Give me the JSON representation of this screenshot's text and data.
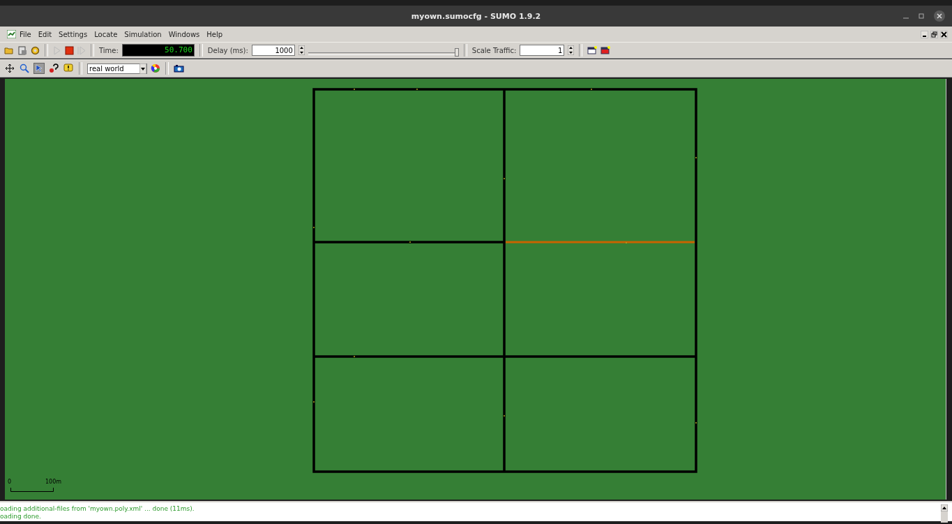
{
  "window": {
    "title": "myown.sumocfg - SUMO 1.9.2"
  },
  "menu": [
    "File",
    "Edit",
    "Settings",
    "Locate",
    "Simulation",
    "Windows",
    "Help"
  ],
  "sim_toolbar": {
    "time_label": "Time:",
    "time": "50.700",
    "delay_label": "Delay (ms):",
    "delay": "1000",
    "delay_slider": {
      "level": 1.0
    },
    "scale_label": "Scale Traffic:",
    "scale": "1"
  },
  "view_toolbar": {
    "tools": [
      {
        "kind": "recenter",
        "selected": false
      },
      {
        "kind": "locate",
        "selected": false
      },
      {
        "kind": "select",
        "selected": true
      },
      {
        "kind": "edit-breakpoints",
        "selected": false
      },
      {
        "kind": "tooltip",
        "selected": false
      }
    ],
    "scheme": "real world"
  },
  "canvas": {
    "scale_bar": {
      "start": "0",
      "end": "100m"
    },
    "highlighted_edge": {
      "color": "#c86400"
    }
  },
  "log": [
    "oading additional-files from 'myown.poly.xml' ... done (11ms).",
    "oading done."
  ]
}
